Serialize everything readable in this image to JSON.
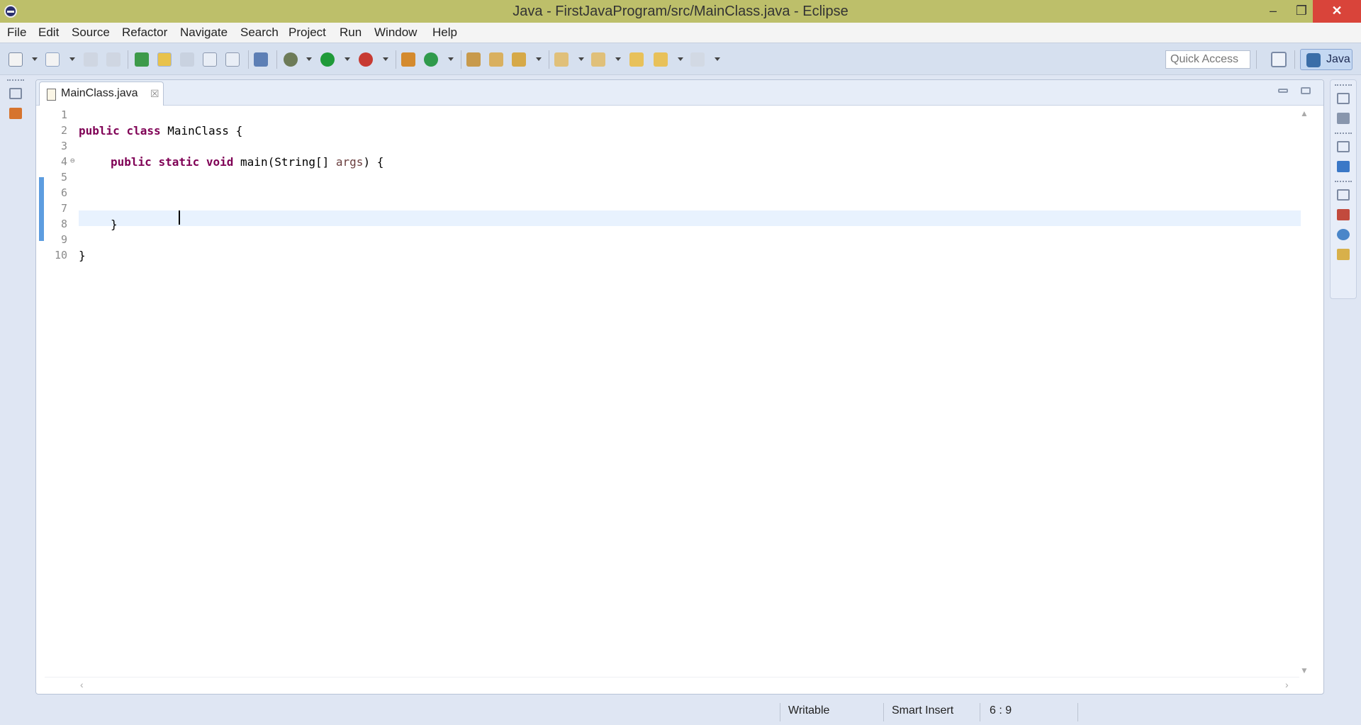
{
  "window": {
    "title": "Java - FirstJavaProgram/src/MainClass.java - Eclipse",
    "minimize_glyph": "‒",
    "restore_glyph": "❐",
    "close_glyph": "✕"
  },
  "menu": {
    "items": [
      "File",
      "Edit",
      "Source",
      "Refactor",
      "Navigate",
      "Search",
      "Project",
      "Run",
      "Window",
      "Help"
    ]
  },
  "toolbar": {
    "quick_access_placeholder": "Quick Access",
    "perspective_label": "Java"
  },
  "editor": {
    "tab": {
      "label": "MainClass.java",
      "close_glyph": "☒"
    },
    "line_numbers": [
      "1",
      "2",
      "3",
      "4",
      "5",
      "6",
      "7",
      "8",
      "9",
      "10"
    ],
    "fold_glyph": "⊖",
    "code": {
      "line2_kw1": "public",
      "line2_kw2": "class",
      "line2_rest": " MainClass {",
      "line4_kw1": "public",
      "line4_kw2": "static",
      "line4_kw3": "void",
      "line4_mid": " main(String[] ",
      "line4_param": "args",
      "line4_end": ") {",
      "line7": "}",
      "line9": "}"
    },
    "scroll_up_glyph": "▲",
    "scroll_down_glyph": "▼",
    "scroll_left_glyph": "‹",
    "scroll_right_glyph": "›"
  },
  "status": {
    "writable": "Writable",
    "insert_mode": "Smart Insert",
    "position": "6 : 9"
  },
  "colors": {
    "titlebar": "#bdbf6a",
    "close_button": "#d9443a",
    "keyword": "#7f0055",
    "current_line": "#e8f2fe",
    "ruler_mark": "#5d9de0"
  }
}
